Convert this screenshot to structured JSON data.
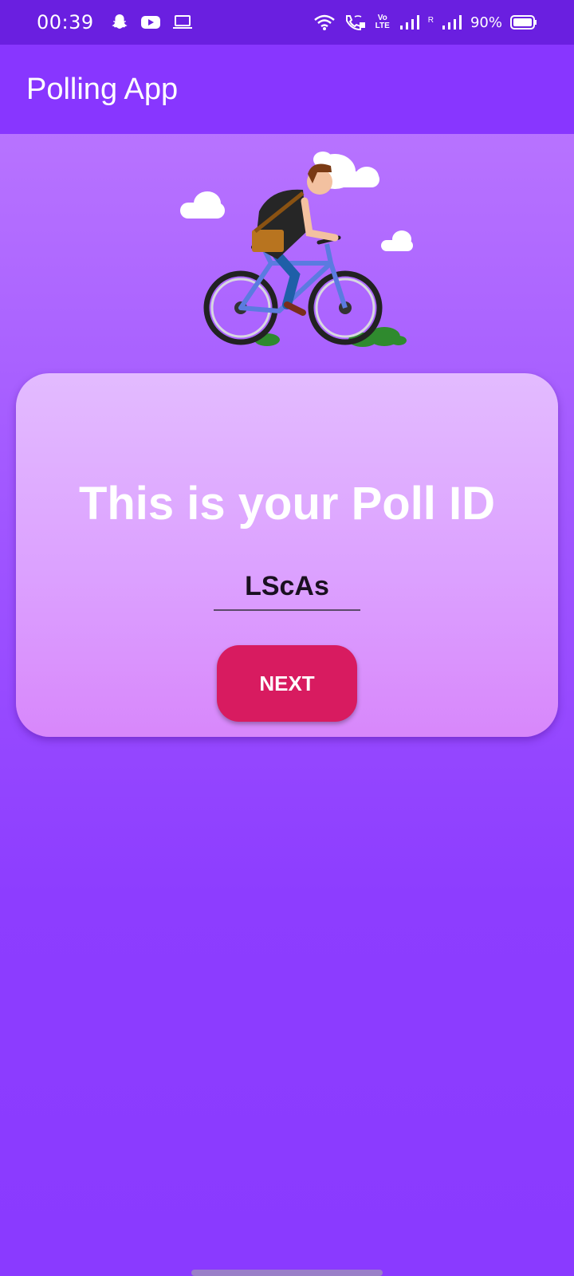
{
  "status_bar": {
    "time": "00:39",
    "battery": "90%",
    "network": "Vo LTE",
    "roaming": "R",
    "icons": [
      "snapchat-icon",
      "youtube-icon",
      "laptop-icon",
      "wifi-icon",
      "wifi-calling-icon",
      "volte-icon",
      "signal-icon",
      "signal-roaming-icon",
      "battery-icon"
    ]
  },
  "app_bar": {
    "title": "Polling App"
  },
  "illustration": {
    "name": "man-riding-bicycle"
  },
  "card": {
    "heading": "This is your Poll ID",
    "poll_id": "LScAs",
    "next_label": "NEXT"
  },
  "colors": {
    "status_bar": "#6a1fe0",
    "app_bar": "#8836ff",
    "accent": "#d81b60"
  }
}
